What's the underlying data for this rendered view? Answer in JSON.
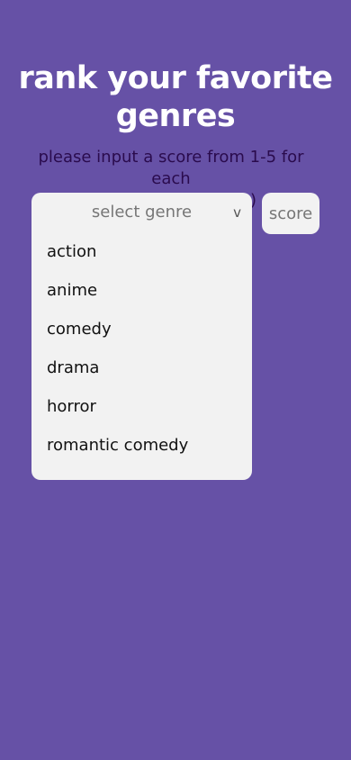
{
  "page": {
    "title": "rank your favorite genres",
    "subtitle": "please input a score from 1-5 for each",
    "partial_text": ")"
  },
  "genre_select": {
    "placeholder": "select genre",
    "chevron": "v",
    "options": [
      "action",
      "anime",
      "comedy",
      "drama",
      "horror",
      "romantic comedy"
    ]
  },
  "score_input": {
    "placeholder": "score"
  },
  "colors": {
    "background": "#6651a6",
    "title_text": "#ffffff",
    "subtitle_text": "#2a0b4d",
    "control_bg": "#f2f2f2",
    "placeholder_text": "#767676"
  }
}
